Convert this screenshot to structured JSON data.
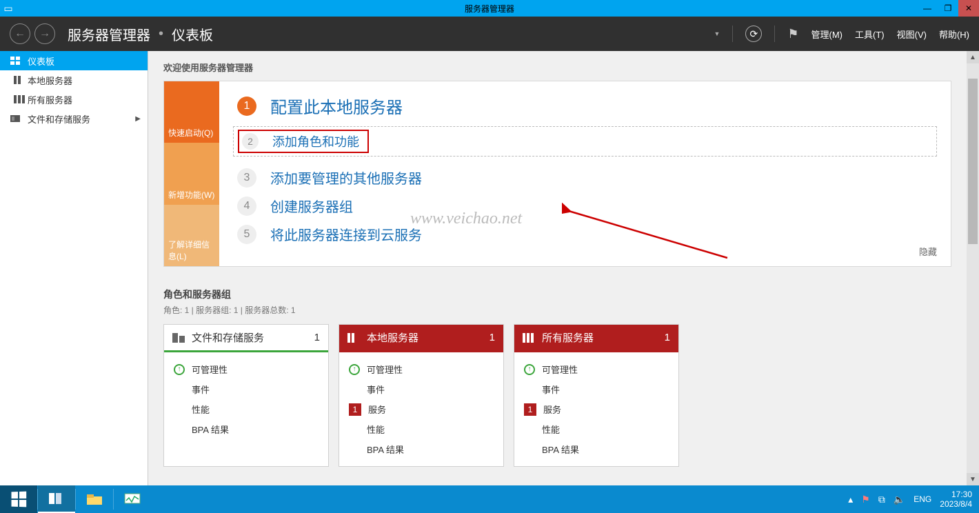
{
  "titlebar": {
    "title": "服务器管理器"
  },
  "header": {
    "breadcrumb": {
      "app": "服务器管理器",
      "page": "仪表板"
    },
    "menus": {
      "manage": "管理(M)",
      "tools": "工具(T)",
      "view": "视图(V)",
      "help": "帮助(H)"
    }
  },
  "sidebar": {
    "items": [
      {
        "label": "仪表板"
      },
      {
        "label": "本地服务器"
      },
      {
        "label": "所有服务器"
      },
      {
        "label": "文件和存储服务"
      }
    ]
  },
  "welcome": {
    "heading": "欢迎使用服务器管理器",
    "tabs": {
      "quickstart": "快速启动(Q)",
      "whatsnew": "新增功能(W)",
      "learnmore": "了解详细信息(L)"
    },
    "steps": {
      "s1": "配置此本地服务器",
      "s2": "添加角色和功能",
      "s3": "添加要管理的其他服务器",
      "s4": "创建服务器组",
      "s5": "将此服务器连接到云服务"
    },
    "nums": {
      "n1": "1",
      "n2": "2",
      "n3": "3",
      "n4": "4",
      "n5": "5"
    },
    "hide": "隐藏"
  },
  "watermark": "www.veichao.net",
  "roles": {
    "heading": "角色和服务器组",
    "sub": "角色: 1 | 服务器组: 1 | 服务器总数: 1",
    "cards": [
      {
        "title": "文件和存储服务",
        "count": "1",
        "items": [
          {
            "status": "ok",
            "label": "可管理性"
          },
          {
            "status": "none",
            "label": "事件"
          },
          {
            "status": "none",
            "label": "性能"
          },
          {
            "status": "none",
            "label": "BPA 结果"
          }
        ]
      },
      {
        "title": "本地服务器",
        "count": "1",
        "items": [
          {
            "status": "ok",
            "label": "可管理性"
          },
          {
            "status": "none",
            "label": "事件"
          },
          {
            "status": "bad",
            "badge": "1",
            "label": "服务"
          },
          {
            "status": "none",
            "label": "性能"
          },
          {
            "status": "none",
            "label": "BPA 结果"
          }
        ]
      },
      {
        "title": "所有服务器",
        "count": "1",
        "items": [
          {
            "status": "ok",
            "label": "可管理性"
          },
          {
            "status": "none",
            "label": "事件"
          },
          {
            "status": "bad",
            "badge": "1",
            "label": "服务"
          },
          {
            "status": "none",
            "label": "性能"
          },
          {
            "status": "none",
            "label": "BPA 结果"
          }
        ]
      }
    ]
  },
  "taskbar": {
    "tray": {
      "lang": "ENG",
      "time": "17:30",
      "date": "2023/8/4"
    }
  }
}
